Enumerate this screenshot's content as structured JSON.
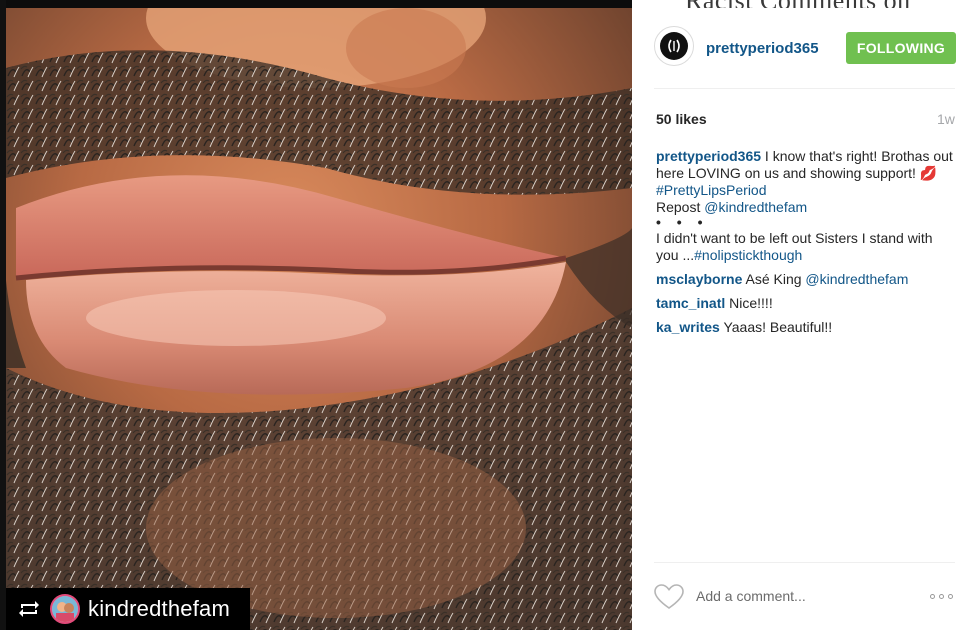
{
  "background_text": "Racist Comments on",
  "photo": {
    "repost_name": "kindredthefam",
    "icons": [
      "repost-icon",
      "avatar-icon"
    ]
  },
  "post": {
    "username": "prettyperiod365",
    "follow_label": "FOLLOWING",
    "likes": "50 likes",
    "age": "1w",
    "caption": {
      "user": "prettyperiod365",
      "text1": " I know that's right! Brothas out here LOVING on us and showing support! ",
      "emoji": "💋",
      "hashtag1": " #PrettyLipsPeriod",
      "repost_prefix": "Repost ",
      "repost_mention": "@kindredthefam",
      "dots": "• • •",
      "text2": "I didn't want to be left out Sisters I stand with you ...",
      "hashtag2": "#nolipstickthough"
    },
    "comments": [
      {
        "user": "msclayborne",
        "text": " Asé King ",
        "mention": "@kindredthefam"
      },
      {
        "user": "tamc_inatl",
        "text": " Nice!!!!",
        "mention": ""
      },
      {
        "user": "ka_writes",
        "text": " Yaaas! Beautiful!!",
        "mention": ""
      }
    ],
    "add_comment_placeholder": "Add a comment...",
    "colors": {
      "link": "#125688",
      "follow_button": "#70c050",
      "meta": "#a5a7aa"
    }
  }
}
